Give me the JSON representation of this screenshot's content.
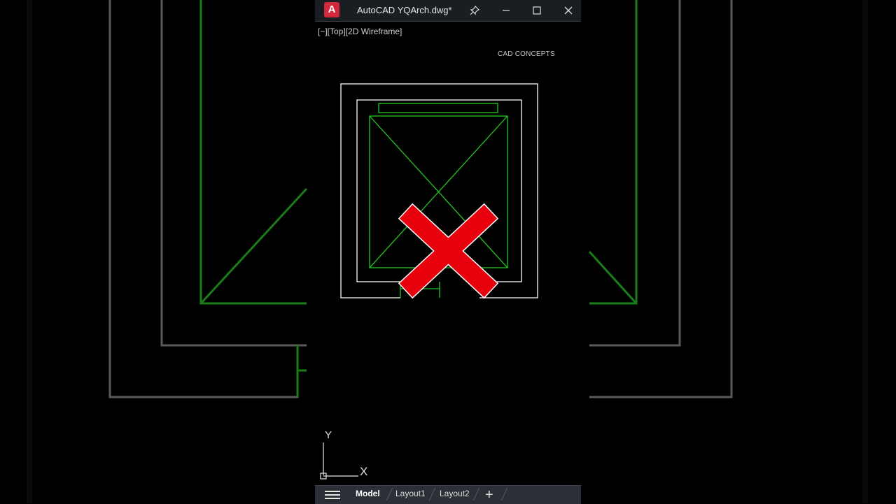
{
  "window": {
    "app_icon_letter": "A",
    "title": "AutoCAD YQArch.dwg*",
    "pin_icon": "pin-icon",
    "minimize_icon": "minimize-icon",
    "maximize_icon": "maximize-icon",
    "close_icon": "close-icon"
  },
  "viewport": {
    "controls_label": "[−][Top][2D Wireframe]",
    "watermark": "CAD CONCEPTS"
  },
  "ucs": {
    "y_label": "Y",
    "x_label": "X"
  },
  "tabs": {
    "items": [
      {
        "label": "Model",
        "active": true
      },
      {
        "label": "Layout1",
        "active": false
      },
      {
        "label": "Layout2",
        "active": false
      }
    ],
    "add_label": "+"
  },
  "colors": {
    "accent_red": "#e8000c",
    "cad_green": "#23c823",
    "cad_white": "#ffffff",
    "brand": "#d5273c"
  }
}
